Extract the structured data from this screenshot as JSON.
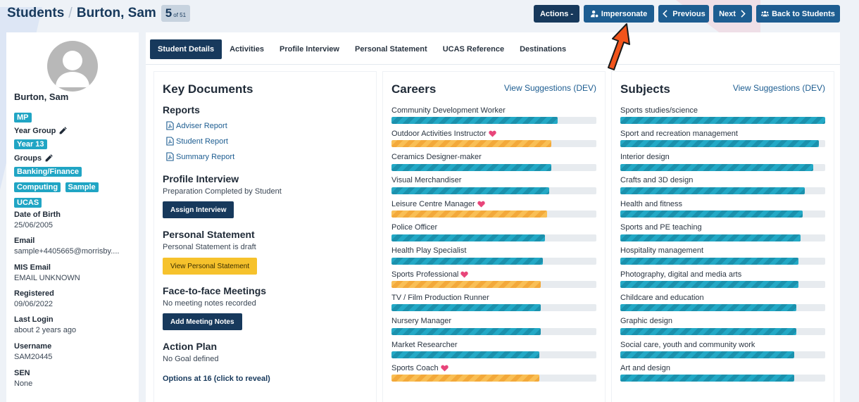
{
  "header": {
    "section": "Students",
    "separator": "/",
    "student_name": "Burton, Sam",
    "counter_num": "5",
    "counter_of": "of 51",
    "buttons": {
      "actions": "Actions -",
      "impersonate": "Impersonate",
      "previous": "Previous",
      "next": "Next",
      "back": "Back to Students"
    }
  },
  "sidebar": {
    "name": "Burton, Sam",
    "tag": "MP",
    "year_group_label": "Year Group",
    "year_group": "Year 13",
    "groups_label": "Groups",
    "groups": [
      "Banking/Finance",
      "Computing",
      "Sample",
      "UCAS"
    ],
    "dob_label": "Date of Birth",
    "dob": "25/06/2005",
    "email_label": "Email",
    "email": "sample+4405665@morrisby....",
    "mis_email_label": "MIS Email",
    "mis_email": "EMAIL UNKNOWN",
    "registered_label": "Registered",
    "registered": "09/06/2022",
    "last_login_label": "Last Login",
    "last_login": "about 2 years ago",
    "username_label": "Username",
    "username": "SAM20445",
    "sen_label": "SEN",
    "sen": "None"
  },
  "tabs": [
    "Student Details",
    "Activities",
    "Profile Interview",
    "Personal Statement",
    "UCAS Reference",
    "Destinations"
  ],
  "key_documents": {
    "title": "Key Documents",
    "reports_title": "Reports",
    "reports": [
      "Adviser Report",
      "Student Report",
      "Summary Report"
    ],
    "profile_title": "Profile Interview",
    "profile_status": "Preparation Completed by Student",
    "assign_button": "Assign Interview",
    "ps_title": "Personal Statement",
    "ps_status": "Personal Statement is draft",
    "ps_button": "View Personal Statement",
    "f2f_title": "Face-to-face Meetings",
    "f2f_status": "No meeting notes recorded",
    "f2f_button": "Add Meeting Notes",
    "action_title": "Action Plan",
    "action_status": "No Goal defined",
    "options_link": "Options at 16 (click to reveal)"
  },
  "careers": {
    "title": "Careers",
    "link": "View Suggestions (DEV)",
    "items": [
      {
        "label": "Community Development Worker",
        "value": 0.81,
        "fav": false
      },
      {
        "label": "Outdoor Activities Instructor",
        "value": 0.78,
        "fav": true
      },
      {
        "label": "Ceramics Designer-maker",
        "value": 0.78,
        "fav": false
      },
      {
        "label": "Visual Merchandiser",
        "value": 0.77,
        "fav": false
      },
      {
        "label": "Leisure Centre Manager",
        "value": 0.76,
        "fav": true
      },
      {
        "label": "Police Officer",
        "value": 0.75,
        "fav": false
      },
      {
        "label": "Health Play Specialist",
        "value": 0.74,
        "fav": false
      },
      {
        "label": "Sports Professional",
        "value": 0.73,
        "fav": true
      },
      {
        "label": "TV / Film Production Runner",
        "value": 0.73,
        "fav": false
      },
      {
        "label": "Nursery Manager",
        "value": 0.73,
        "fav": false
      },
      {
        "label": "Market Researcher",
        "value": 0.72,
        "fav": false
      },
      {
        "label": "Sports Coach",
        "value": 0.72,
        "fav": true
      }
    ]
  },
  "subjects": {
    "title": "Subjects",
    "link": "View Suggestions (DEV)",
    "items": [
      {
        "label": "Sports studies/science",
        "value": 1.0
      },
      {
        "label": "Sport and recreation management",
        "value": 0.97
      },
      {
        "label": "Interior design",
        "value": 0.94
      },
      {
        "label": "Crafts and 3D design",
        "value": 0.9
      },
      {
        "label": "Health and fitness",
        "value": 0.89
      },
      {
        "label": "Sports and PE teaching",
        "value": 0.88
      },
      {
        "label": "Hospitality management",
        "value": 0.87
      },
      {
        "label": "Photography, digital and media arts",
        "value": 0.87
      },
      {
        "label": "Childcare and education",
        "value": 0.86
      },
      {
        "label": "Graphic design",
        "value": 0.86
      },
      {
        "label": "Social care, youth and community work",
        "value": 0.85
      },
      {
        "label": "Art and design",
        "value": 0.85
      }
    ]
  },
  "colors": {
    "navy": "#17395c",
    "blue": "#1d5d91",
    "teal": "#20a5c4",
    "orange": "#f6b042",
    "yellow": "#f6c22c",
    "heart": "#e8457a",
    "arrow": "#f2541b"
  }
}
